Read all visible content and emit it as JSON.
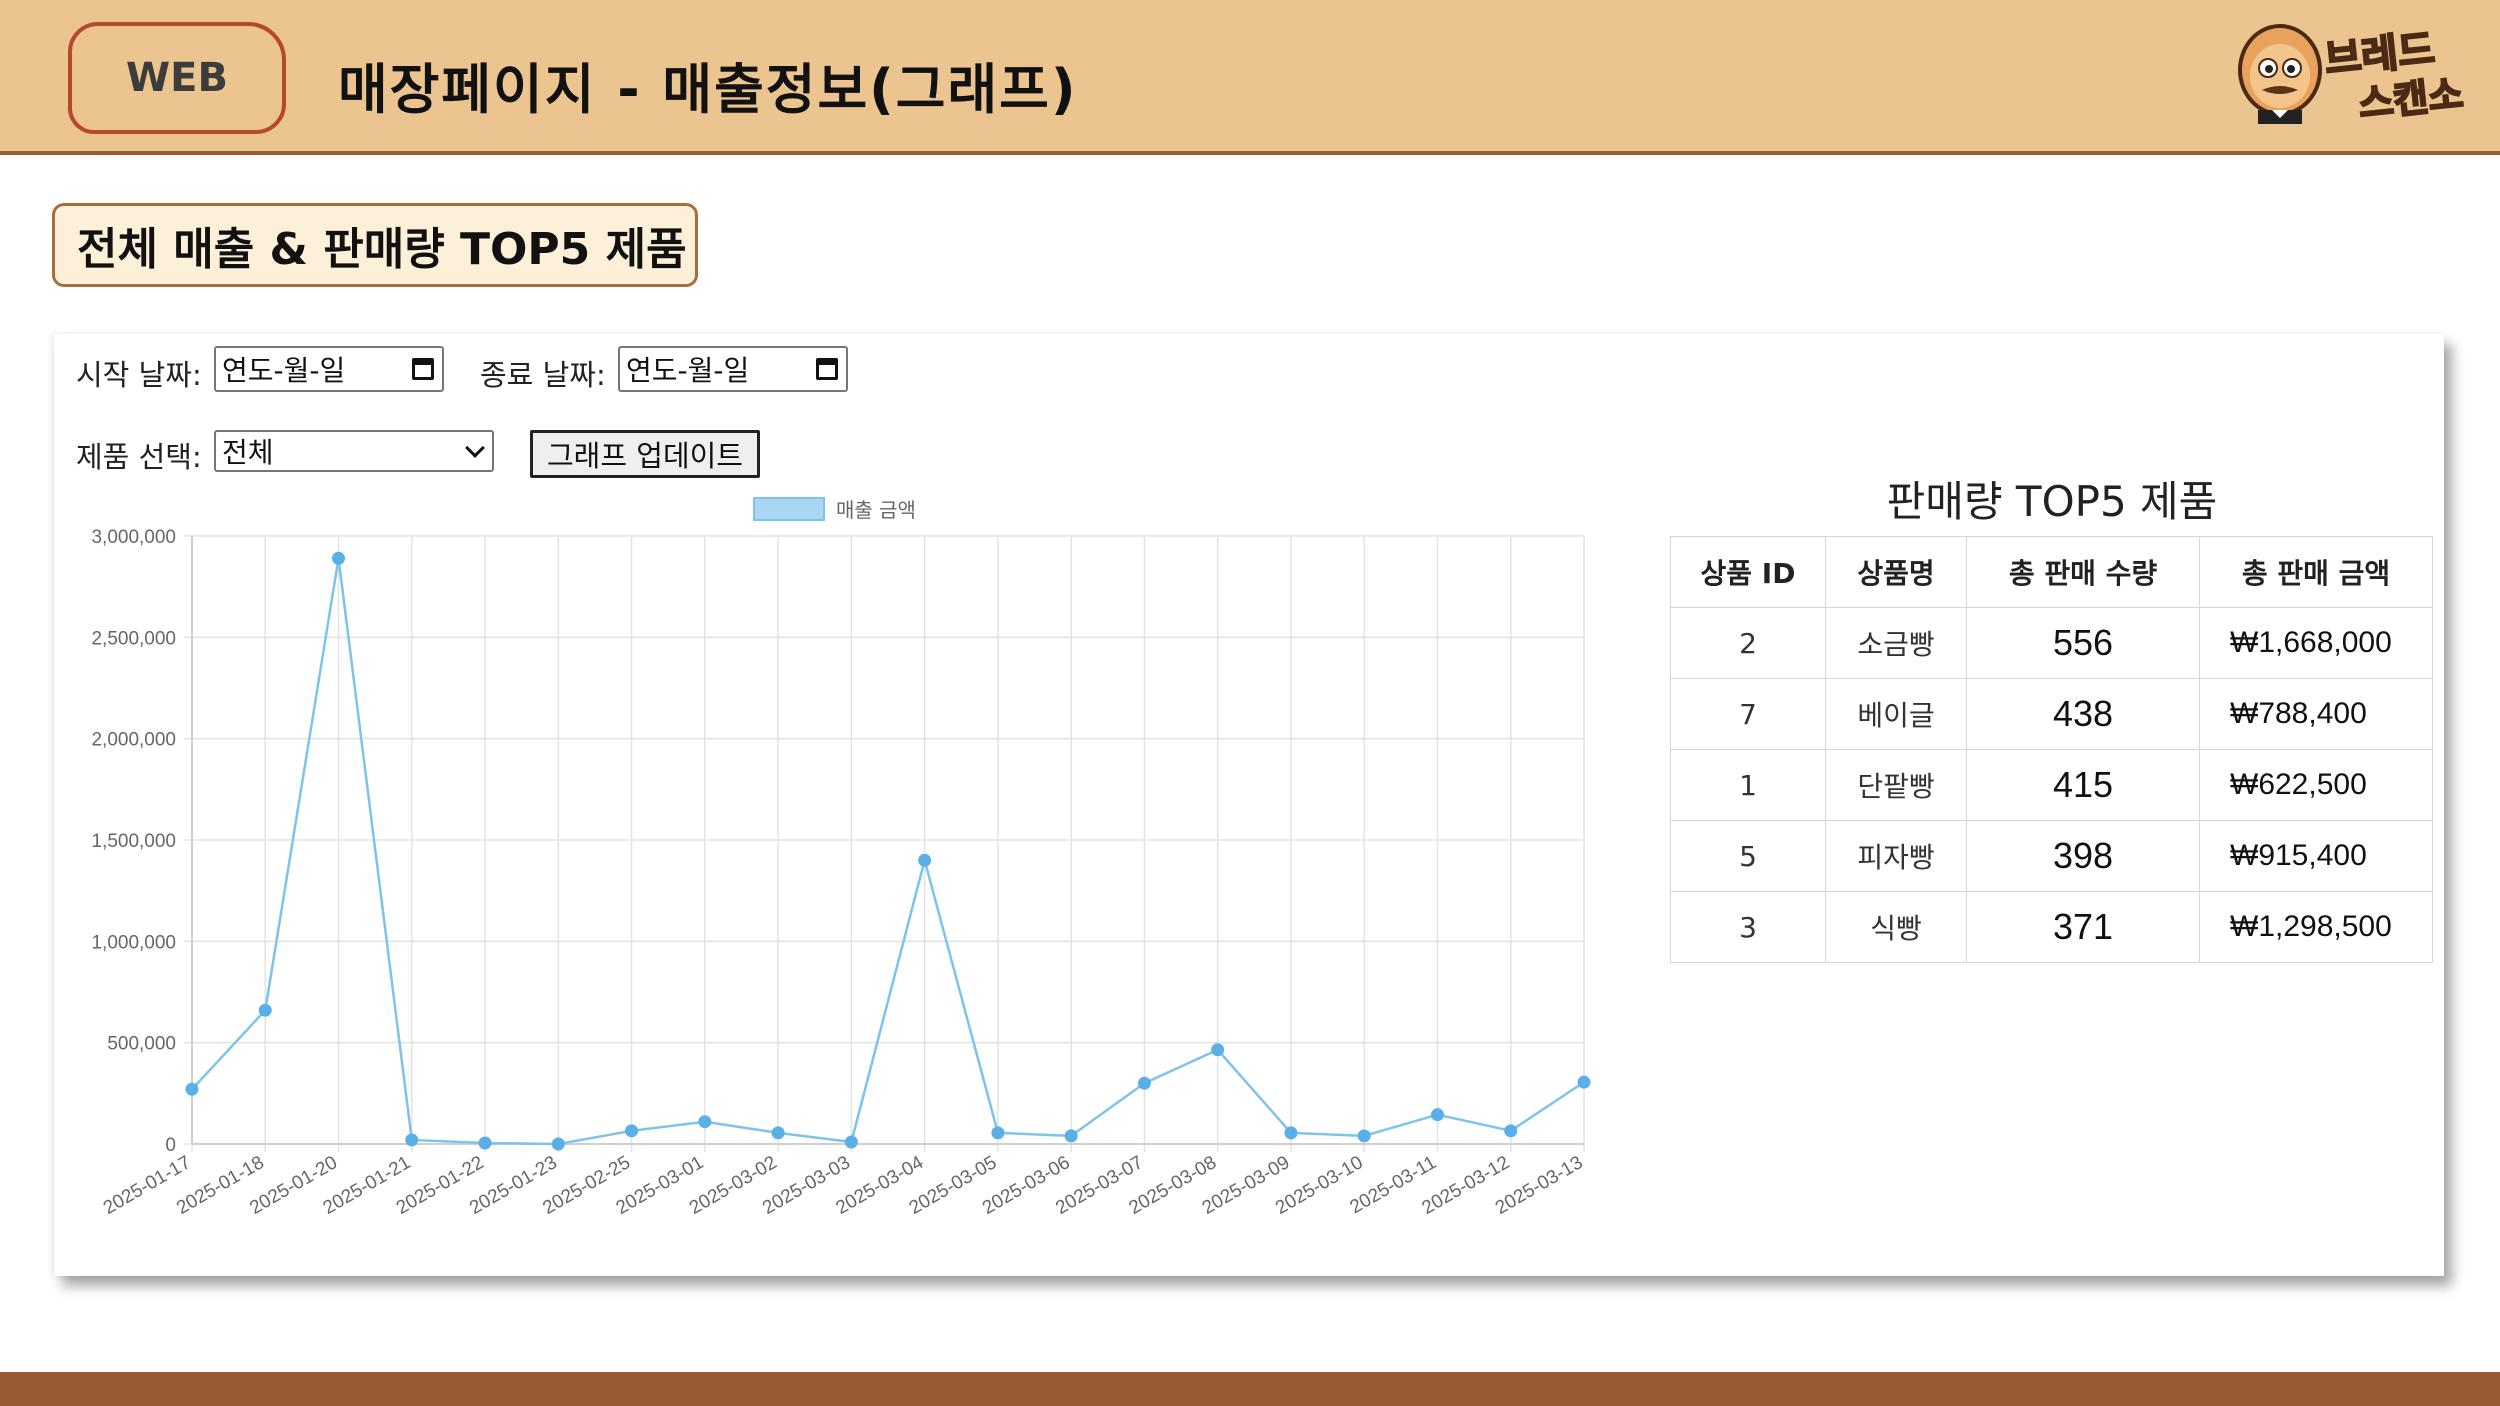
{
  "header": {
    "badge": "WEB",
    "title": "매장페이지 - 매출정보(그래프)",
    "logo_line1": "브레드",
    "logo_line2": "스캔소"
  },
  "section": {
    "label": "전체 매출 & 판매량 TOP5 제품"
  },
  "filters": {
    "start_label": "시작 날짜:",
    "start_value": "연도-월-일",
    "end_label": "종료 날짜:",
    "end_value": "연도-월-일",
    "product_label": "제품 선택:",
    "product_value": "전체",
    "update_button": "그래프 업데이트"
  },
  "chart_data": {
    "type": "line",
    "legend": [
      "매출 금액"
    ],
    "legend_position": "top-center",
    "grid": true,
    "color": "#7ec3ea",
    "ylim": [
      0,
      3000000
    ],
    "yticks": [
      "0",
      "500,000",
      "1,000,000",
      "1,500,000",
      "2,000,000",
      "2,500,000",
      "3,000,000"
    ],
    "x": [
      "2025-01-17",
      "2025-01-18",
      "2025-01-20",
      "2025-01-21",
      "2025-01-22",
      "2025-01-23",
      "2025-02-25",
      "2025-03-01",
      "2025-03-02",
      "2025-03-03",
      "2025-03-04",
      "2025-03-05",
      "2025-03-06",
      "2025-03-07",
      "2025-03-08",
      "2025-03-09",
      "2025-03-10",
      "2025-03-11",
      "2025-03-12",
      "2025-03-13"
    ],
    "series": [
      {
        "name": "매출 금액",
        "values": [
          270000,
          660000,
          2890000,
          20000,
          5000,
          0,
          65000,
          110000,
          55000,
          10000,
          1400000,
          55000,
          40000,
          300000,
          465000,
          55000,
          40000,
          145000,
          65000,
          305000
        ]
      }
    ]
  },
  "table": {
    "title": "판매량 TOP5 제품",
    "headers": [
      "상품 ID",
      "상품명",
      "총 판매 수량",
      "총 판매 금액"
    ],
    "rows": [
      [
        "2",
        "소금빵",
        "556",
        "₩1,668,000"
      ],
      [
        "7",
        "베이글",
        "438",
        "₩788,400"
      ],
      [
        "1",
        "단팥빵",
        "415",
        "₩622,500"
      ],
      [
        "5",
        "피자빵",
        "398",
        "₩915,400"
      ],
      [
        "3",
        "식빵",
        "371",
        "₩1,298,500"
      ]
    ]
  }
}
